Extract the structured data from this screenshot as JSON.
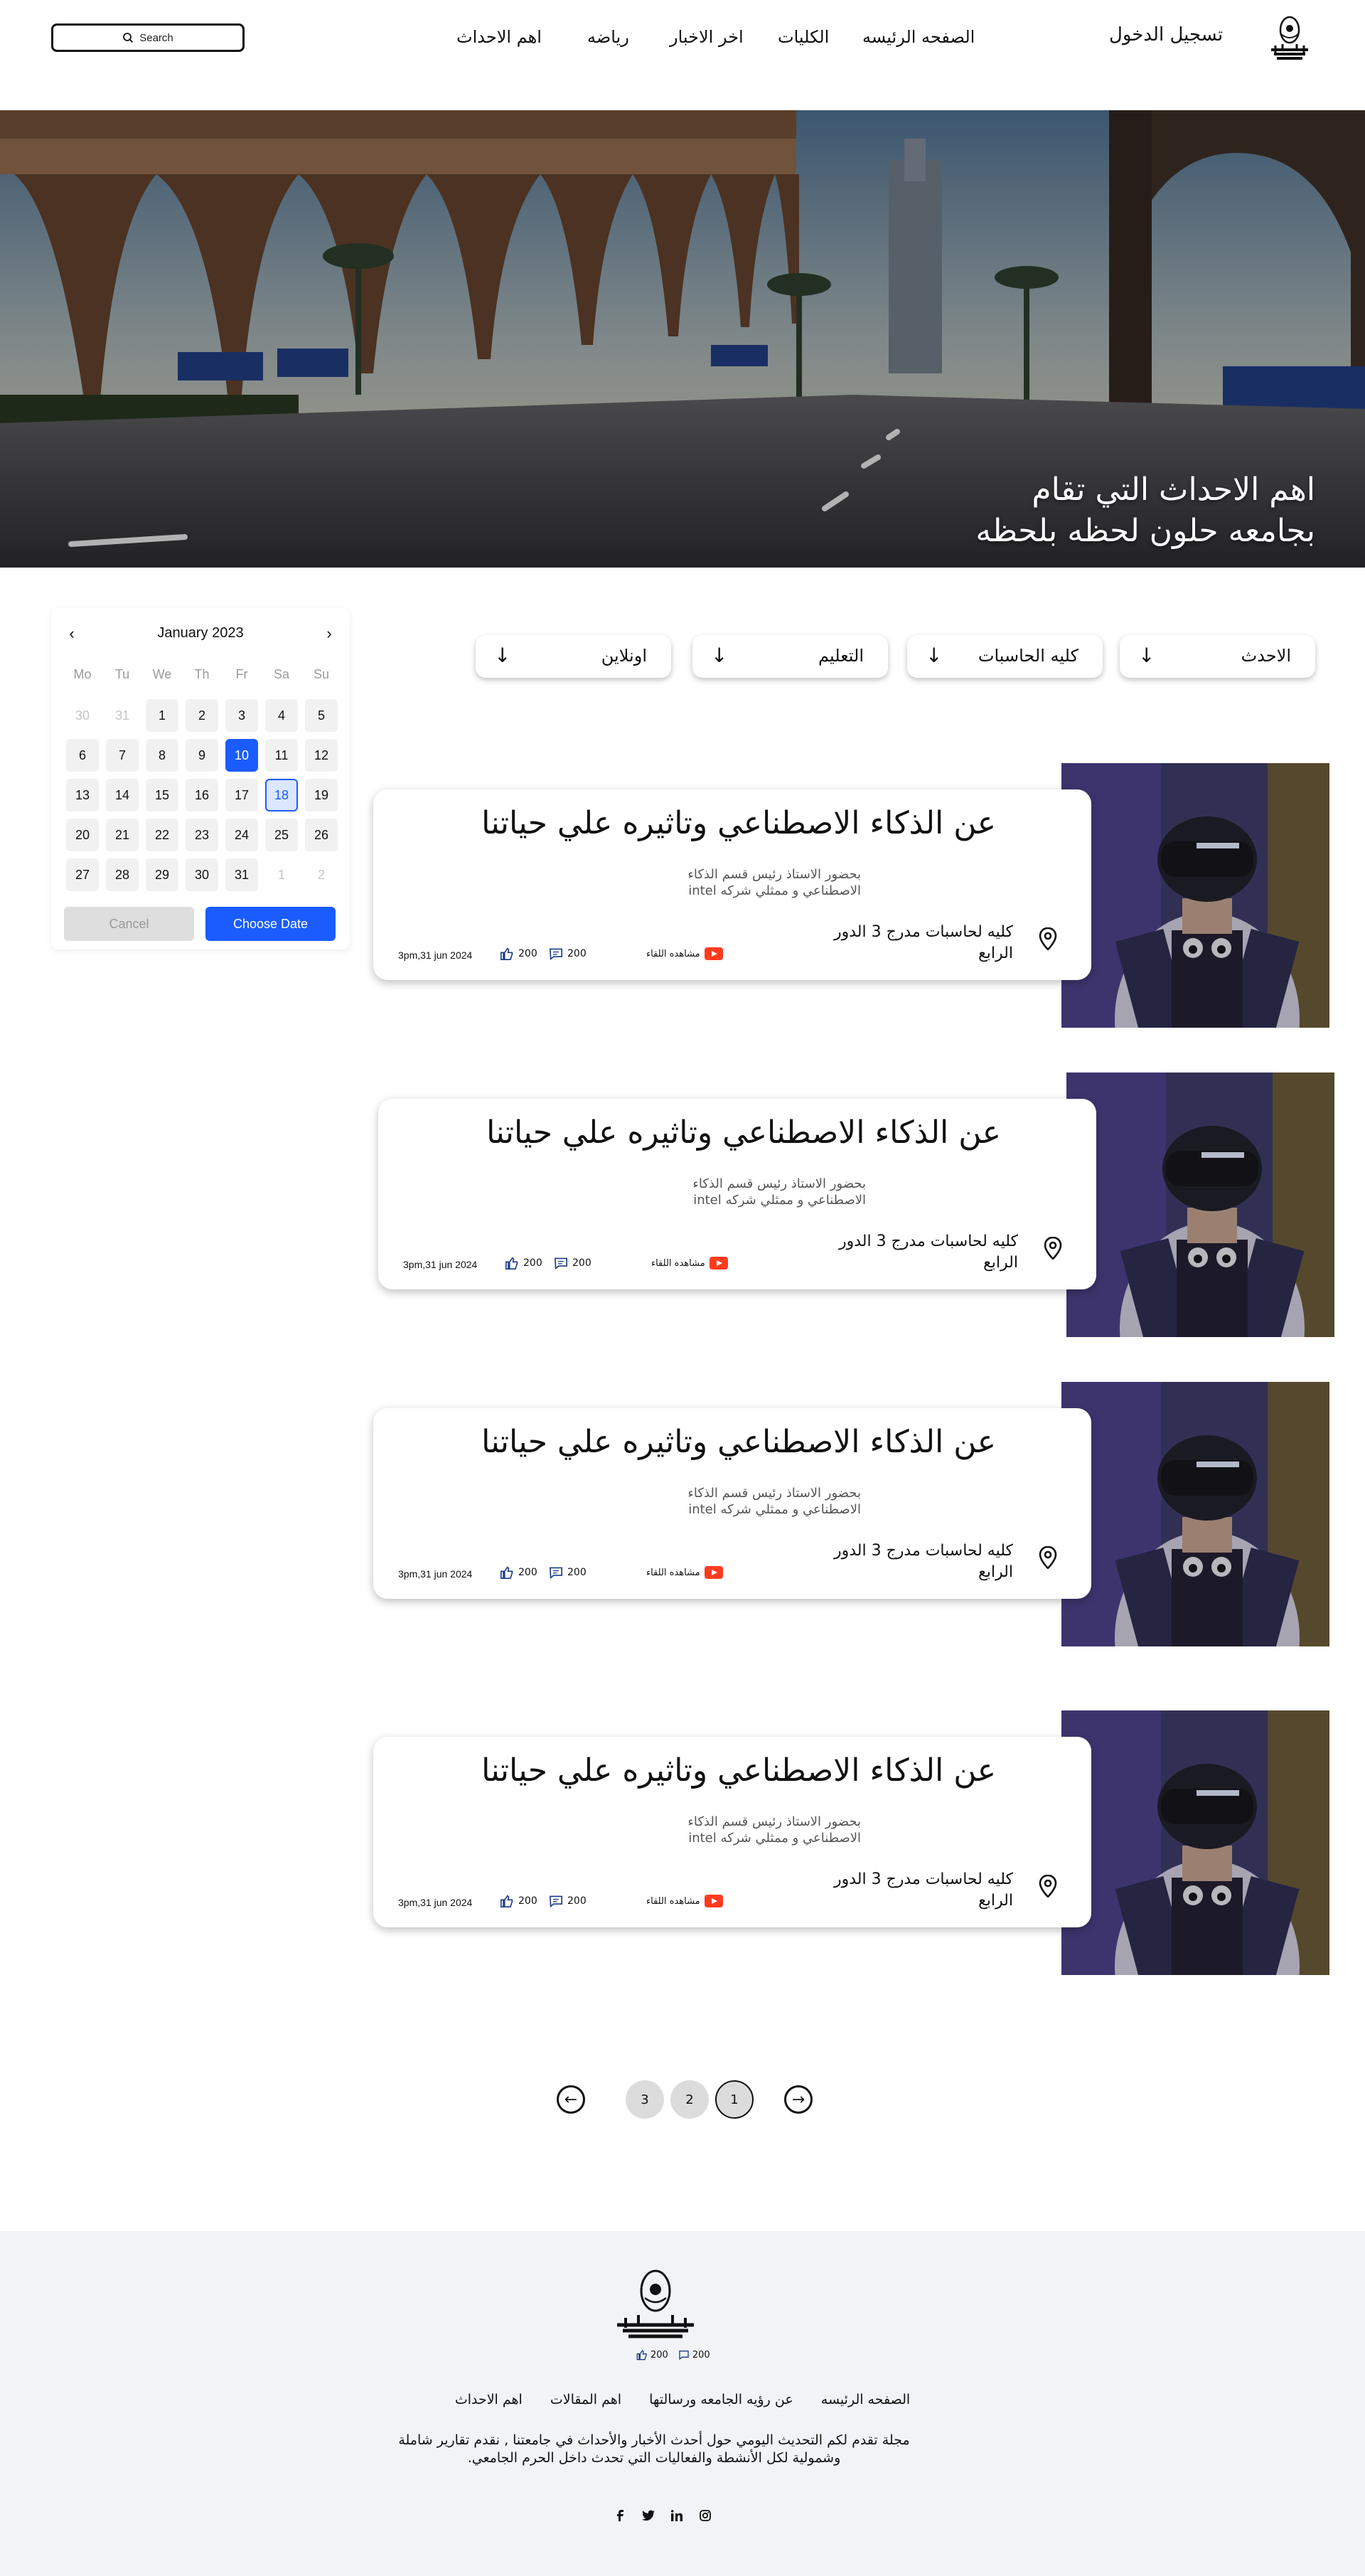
{
  "header": {
    "search_label": "Search",
    "nav": [
      "الصفحه الرئيسه",
      "الكليات",
      "اخر الاخبار",
      "رياضه",
      "اهم الاحداث"
    ],
    "login": "تسجيل الدخول",
    "logo_icon": "helwan-university-logo"
  },
  "hero": {
    "title_line1": "اهم الاحداث التي تقام",
    "title_line2": "بجامعه حلون لحظه بلحظه"
  },
  "calendar": {
    "month": "January 2023",
    "weekdays": [
      "Mo",
      "Tu",
      "We",
      "Th",
      "Fr",
      "Sa",
      "Su"
    ],
    "days": [
      {
        "d": "30",
        "state": "muted"
      },
      {
        "d": "31",
        "state": "muted"
      },
      {
        "d": "1"
      },
      {
        "d": "2"
      },
      {
        "d": "3"
      },
      {
        "d": "4"
      },
      {
        "d": "5"
      },
      {
        "d": "6"
      },
      {
        "d": "7"
      },
      {
        "d": "8"
      },
      {
        "d": "9"
      },
      {
        "d": "10",
        "state": "selected"
      },
      {
        "d": "11"
      },
      {
        "d": "12"
      },
      {
        "d": "13"
      },
      {
        "d": "14"
      },
      {
        "d": "15"
      },
      {
        "d": "16"
      },
      {
        "d": "17"
      },
      {
        "d": "18",
        "state": "today"
      },
      {
        "d": "19"
      },
      {
        "d": "20"
      },
      {
        "d": "21"
      },
      {
        "d": "22"
      },
      {
        "d": "23"
      },
      {
        "d": "24"
      },
      {
        "d": "25"
      },
      {
        "d": "26"
      },
      {
        "d": "27"
      },
      {
        "d": "28"
      },
      {
        "d": "29"
      },
      {
        "d": "30"
      },
      {
        "d": "31"
      },
      {
        "d": "1",
        "state": "muted"
      },
      {
        "d": "2",
        "state": "muted"
      }
    ],
    "cancel": "Cancel",
    "choose": "Choose Date",
    "accent": "#1a5cff"
  },
  "filters": [
    "الاحدث",
    "كليه الحاسبات",
    "التعليم",
    "اونلاين"
  ],
  "events": [
    {
      "title": "عن الذكاء الاصطناعي وتاثيره علي حياتنا",
      "desc": "بحضور الاستاذ رئيس قسم الذكاء الاصطناعي و ممثلي شركه intel",
      "location": "كليه لحاسبات مدرج 3 الدور الرابع",
      "date": "3pm,31 jun 2024",
      "likes": "200",
      "comments": "200",
      "watch": "مشاهده اللقاء"
    },
    {
      "title": "عن الذكاء الاصطناعي وتاثيره علي حياتنا",
      "desc": "بحضور الاستاذ رئيس قسم الذكاء الاصطناعي و ممثلي شركه intel",
      "location": "كليه لحاسبات مدرج 3 الدور الرابع",
      "date": "3pm,31 jun 2024",
      "likes": "200",
      "comments": "200",
      "watch": "مشاهده اللقاء"
    },
    {
      "title": "عن الذكاء الاصطناعي وتاثيره علي حياتنا",
      "desc": "بحضور الاستاذ رئيس قسم الذكاء الاصطناعي و ممثلي شركه intel",
      "location": "كليه لحاسبات مدرج 3 الدور الرابع",
      "date": "3pm,31 jun 2024",
      "likes": "200",
      "comments": "200",
      "watch": "مشاهده اللقاء"
    },
    {
      "title": "عن الذكاء الاصطناعي وتاثيره علي حياتنا",
      "desc": "بحضور الاستاذ رئيس قسم الذكاء الاصطناعي و ممثلي شركه intel",
      "location": "كليه لحاسبات مدرج 3 الدور الرابع",
      "date": "3pm,31 jun 2024",
      "likes": "200",
      "comments": "200",
      "watch": "مشاهده اللقاء"
    }
  ],
  "pagination": {
    "pages": [
      "3",
      "2",
      "1"
    ],
    "active": "1"
  },
  "footer": {
    "likes": "200",
    "comments": "200",
    "links": [
      "الصفحه الرئيسه",
      "عن رؤيه الجامعه ورسالتها",
      "اهم المقالات",
      "اهم الاحداث"
    ],
    "about": "مجلة تقدم لكم التحديث اليومي حول أحدث الأخبار والأحداث في جامعتنا , نقدم تقارير شاملة وشمولية لكل الأنشطة والفعاليات التي تحدث داخل الحرم الجامعي.",
    "social": [
      "facebook-icon",
      "twitter-icon",
      "linkedin-icon",
      "instagram-icon"
    ]
  }
}
